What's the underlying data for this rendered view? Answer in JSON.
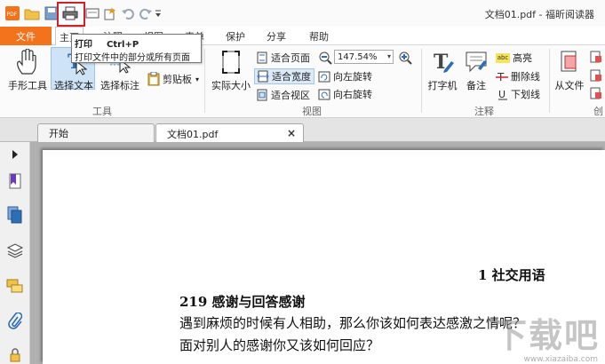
{
  "window": {
    "title": "文档01.pdf - 福昕阅读器"
  },
  "menubar": {
    "file": "文件",
    "tabs": [
      "主页",
      "注释",
      "视图",
      "表单",
      "保护",
      "分享",
      "帮助"
    ]
  },
  "tooltip": {
    "title": "打印",
    "shortcut": "Ctrl+P",
    "description": "打印文件中的部分或所有页面"
  },
  "ribbon": {
    "tools": {
      "hand": "手形工具",
      "select_text": "选择文本",
      "select_mark": "选择标注",
      "clipboard": "剪贴板",
      "group": "工具"
    },
    "view": {
      "actual_size": "实际大小",
      "fit_page": "适合页面",
      "fit_width": "适合宽度",
      "fit_visible": "适合视区",
      "zoom": "147.54%",
      "rotate_left": "向左旋转",
      "rotate_right": "向右旋转",
      "group": "视图"
    },
    "comment": {
      "typewriter": "打字机",
      "note": "备注",
      "highlight": "高亮",
      "highlight_badge": "abc",
      "strikeout": "删除线",
      "underline": "下划线",
      "group": "注释"
    },
    "create": {
      "from_file": "从文件",
      "group": "创"
    }
  },
  "tabs": {
    "start": "开始",
    "doc": "文档01.pdf"
  },
  "document": {
    "chapter": "1  社交用语",
    "section": "219  感谢与回答感谢",
    "line1": "遇到麻烦的时候有人相助，那么你该如何表达感激之情呢？",
    "line2": "面对别人的感谢你又该如何回应？"
  },
  "watermark": {
    "logo": "下载吧",
    "url": "www.xiazaiba.com"
  },
  "colors": {
    "file_menu": "#f2731b",
    "print_highlight": "#d2202a"
  }
}
